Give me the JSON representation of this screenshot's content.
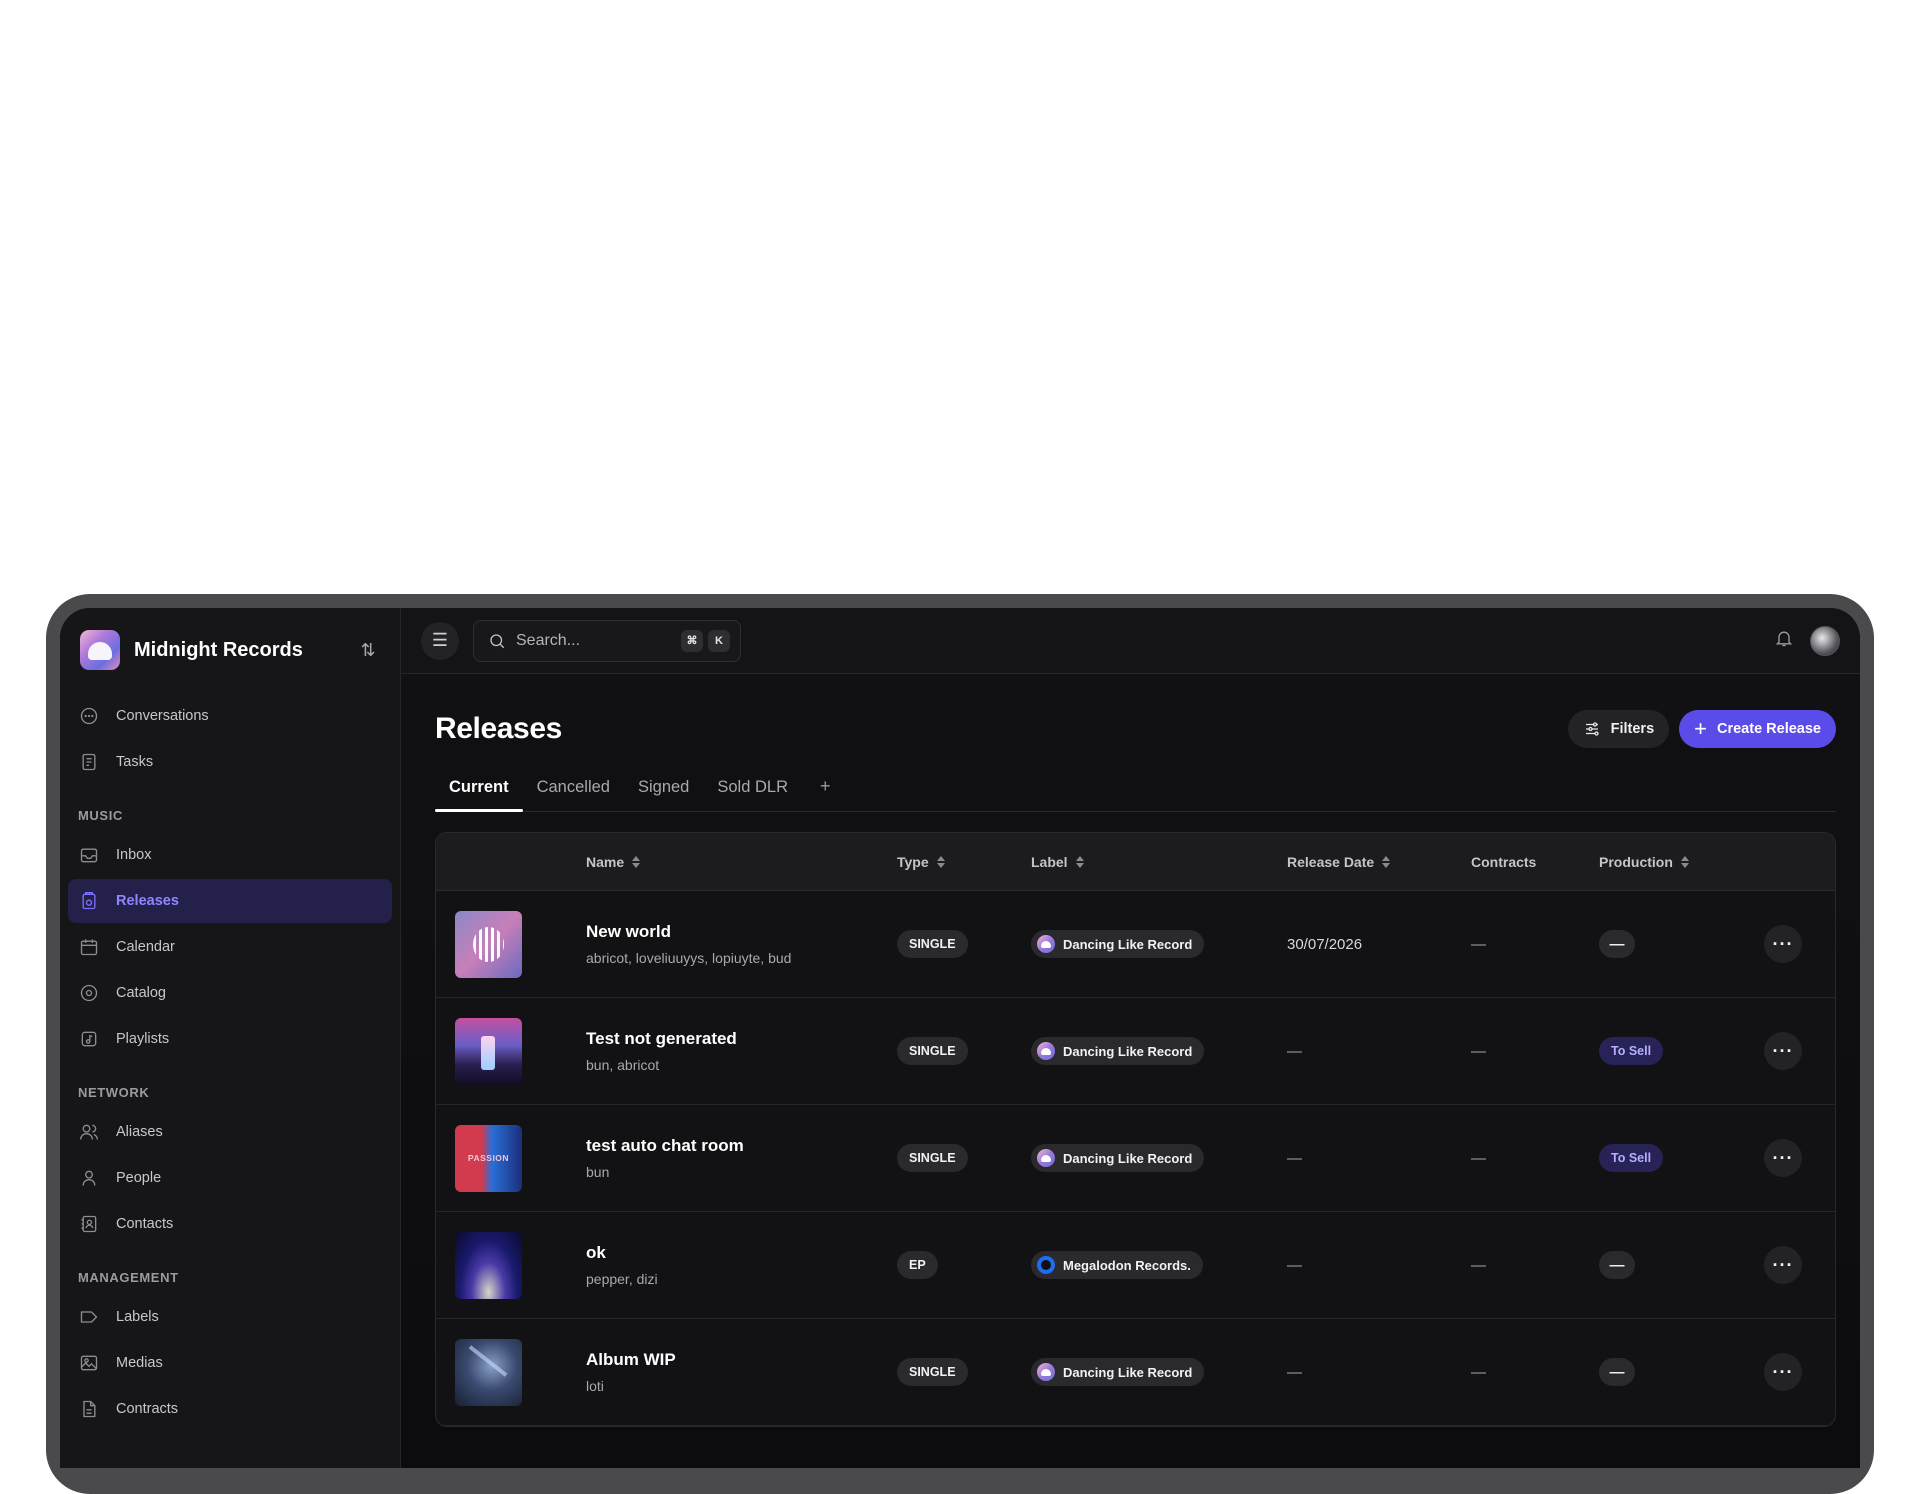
{
  "brand": {
    "name": "Midnight Records"
  },
  "sidebar": {
    "top_items": [
      {
        "label": "Conversations",
        "icon": "chat-icon"
      },
      {
        "label": "Tasks",
        "icon": "task-icon"
      }
    ],
    "sections": [
      {
        "title": "MUSIC",
        "items": [
          {
            "label": "Inbox",
            "icon": "inbox-icon"
          },
          {
            "label": "Releases",
            "icon": "release-icon",
            "active": true
          },
          {
            "label": "Calendar",
            "icon": "calendar-icon"
          },
          {
            "label": "Catalog",
            "icon": "disc-icon"
          },
          {
            "label": "Playlists",
            "icon": "playlist-icon"
          }
        ]
      },
      {
        "title": "NETWORK",
        "items": [
          {
            "label": "Aliases",
            "icon": "users-icon"
          },
          {
            "label": "People",
            "icon": "person-icon"
          },
          {
            "label": "Contacts",
            "icon": "contacts-icon"
          }
        ]
      },
      {
        "title": "MANAGEMENT",
        "items": [
          {
            "label": "Labels",
            "icon": "tag-icon"
          },
          {
            "label": "Medias",
            "icon": "image-icon"
          },
          {
            "label": "Contracts",
            "icon": "document-icon"
          }
        ]
      }
    ]
  },
  "topbar": {
    "search_placeholder": "Search...",
    "shortcut_keys": [
      "⌘",
      "K"
    ]
  },
  "page": {
    "title": "Releases",
    "filters_label": "Filters",
    "create_label": "Create Release",
    "tabs": [
      "Current",
      "Cancelled",
      "Signed",
      "Sold DLR"
    ],
    "add_tab": "+"
  },
  "table": {
    "columns": [
      "Name",
      "Type",
      "Label",
      "Release Date",
      "Contracts",
      "Production"
    ],
    "rows": [
      {
        "name": "New world",
        "artists": "abricot, loveliuuyys, lopiuyte, bud",
        "type": "SINGLE",
        "label": "Dancing Like Record",
        "release_date": "30/07/2026",
        "contracts": "—",
        "production": "—"
      },
      {
        "name": "Test not generated",
        "artists": "bun, abricot",
        "type": "SINGLE",
        "label": "Dancing Like Record",
        "release_date": "—",
        "contracts": "—",
        "production": "To Sell"
      },
      {
        "name": "test auto chat room",
        "artists": "bun",
        "type": "SINGLE",
        "label": "Dancing Like Record",
        "release_date": "—",
        "contracts": "—",
        "production": "To Sell"
      },
      {
        "name": "ok",
        "artists": "pepper, dizi",
        "type": "EP",
        "label": "Megalodon Records.",
        "release_date": "—",
        "contracts": "—",
        "production": "—"
      },
      {
        "name": "Album WIP",
        "artists": "loti",
        "type": "SINGLE",
        "label": "Dancing Like Record",
        "release_date": "—",
        "contracts": "—",
        "production": "—"
      }
    ],
    "more_glyph": "···"
  },
  "colors": {
    "accent": "#5a4ce8",
    "active_nav_bg": "#23214a",
    "to_sell_bg": "#272357"
  }
}
